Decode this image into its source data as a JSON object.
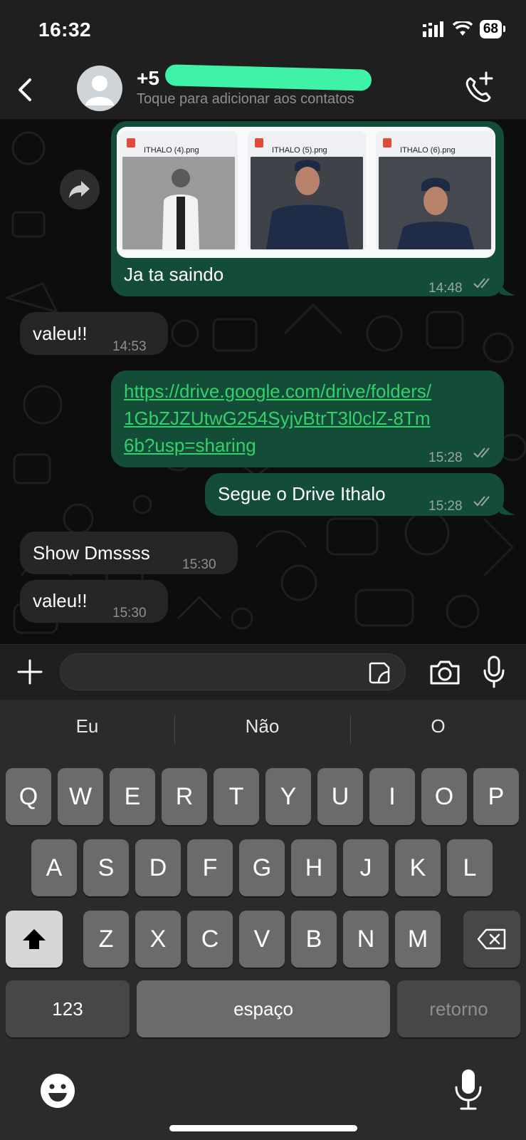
{
  "status_bar": {
    "time": "16:32",
    "battery": "68"
  },
  "header": {
    "contact_name": "+5",
    "subtitle": "Toque para adicionar aos contatos"
  },
  "messages": {
    "m1": {
      "files": [
        "ITHALO (4).png",
        "ITHALO (5).png",
        "ITHALO (6).png"
      ],
      "text": "Ja ta saindo",
      "time": "14:48"
    },
    "m2": {
      "text": "valeu!!",
      "time": "14:53"
    },
    "m3": {
      "link_line1": "https://drive.google.com/drive/folders/",
      "link_line2": "1GbZJZUtwG254SyjvBtrT3l0clZ-8Tm",
      "link_line3": "6b?usp=sharing",
      "time": "15:28"
    },
    "m4": {
      "text": "Segue o Drive Ithalo",
      "time": "15:28"
    },
    "m5": {
      "text": "Show Dmssss",
      "time": "15:30"
    },
    "m6": {
      "text": "valeu!!",
      "time": "15:30"
    }
  },
  "composer": {
    "value": ""
  },
  "keyboard": {
    "suggestions": [
      "Eu",
      "Não",
      "O"
    ],
    "row1": [
      "Q",
      "W",
      "E",
      "R",
      "T",
      "Y",
      "U",
      "I",
      "O",
      "P"
    ],
    "row2": [
      "A",
      "S",
      "D",
      "F",
      "G",
      "H",
      "J",
      "K",
      "L"
    ],
    "row3": [
      "Z",
      "X",
      "C",
      "V",
      "B",
      "N",
      "M"
    ],
    "numbers": "123",
    "space": "espaço",
    "return": "retorno"
  },
  "colors": {
    "outgoing": "#144d37",
    "incoming": "#262626",
    "link": "#33d16b"
  },
  "icons": [
    "back-icon",
    "avatar-icon",
    "add-call-icon",
    "forward-icon",
    "plus-icon",
    "sticker-icon",
    "camera-icon",
    "mic-icon",
    "shift-icon",
    "backspace-icon",
    "emoji-icon",
    "dictation-icon"
  ]
}
